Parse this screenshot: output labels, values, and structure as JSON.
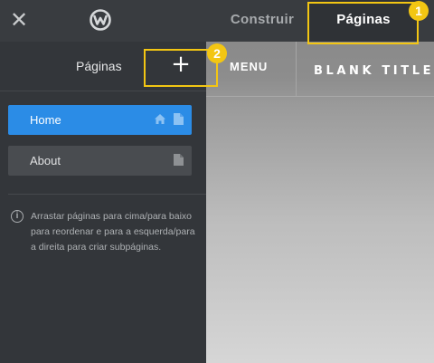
{
  "topbar": {
    "close_icon": "close-icon",
    "logo_icon": "weebly-logo",
    "tabs": [
      {
        "label": "Construir",
        "active": false
      },
      {
        "label": "Páginas",
        "active": true
      }
    ]
  },
  "panel": {
    "title": "Páginas",
    "add_icon": "plus-icon",
    "pages": [
      {
        "label": "Home",
        "selected": true,
        "icons": [
          "home-icon",
          "page-icon"
        ]
      },
      {
        "label": "About",
        "selected": false,
        "icons": [
          "page-icon"
        ]
      }
    ],
    "help_text": "Arrastar páginas para cima/para baixo para reordenar e para a esquerda/para a direita para criar subpáginas."
  },
  "preview": {
    "menu_label": "MENU",
    "site_title": "BLANK TITLE"
  },
  "tutorial": {
    "badges": [
      "1",
      "2"
    ],
    "highlight_color": "#f3c613"
  },
  "colors": {
    "accent": "#2b8ce6",
    "topbar": "#393c40",
    "panel": "#33363a"
  }
}
